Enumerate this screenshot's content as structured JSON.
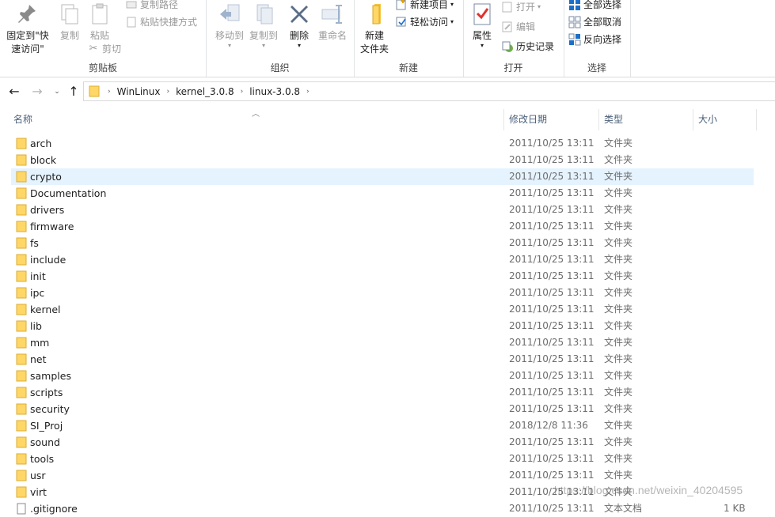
{
  "ribbon": {
    "clipboard": {
      "label": "剪贴板",
      "pin_label": "固定到\"快速访问\"",
      "copy_label": "复制",
      "paste_label": "粘贴",
      "copy_path_label": "复制路径",
      "paste_shortcut_label": "粘贴快捷方式",
      "cut_label": "剪切"
    },
    "organize": {
      "label": "组织",
      "move_to_label": "移动到",
      "copy_to_label": "复制到",
      "delete_label": "删除",
      "rename_label": "重命名"
    },
    "new": {
      "label": "新建",
      "new_folder_label": "新建\n文件夹",
      "new_item_label": "新建项目",
      "easy_access_label": "轻松访问"
    },
    "open": {
      "label": "打开",
      "properties_label": "属性",
      "open_label": "打开",
      "edit_label": "编辑",
      "history_label": "历史记录"
    },
    "select": {
      "label": "选择",
      "select_all_label": "全部选择",
      "select_none_label": "全部取消",
      "invert_label": "反向选择"
    }
  },
  "nav": {
    "breadcrumb": [
      "WinLinux",
      "kernel_3.0.8",
      "linux-3.0.8"
    ]
  },
  "columns": {
    "name": "名称",
    "date": "修改日期",
    "type": "类型",
    "size": "大小"
  },
  "files": [
    {
      "name": "arch",
      "date": "2011/10/25 13:11",
      "type": "文件夹",
      "size": "",
      "kind": "folder"
    },
    {
      "name": "block",
      "date": "2011/10/25 13:11",
      "type": "文件夹",
      "size": "",
      "kind": "folder"
    },
    {
      "name": "crypto",
      "date": "2011/10/25 13:11",
      "type": "文件夹",
      "size": "",
      "kind": "folder",
      "selected": true
    },
    {
      "name": "Documentation",
      "date": "2011/10/25 13:11",
      "type": "文件夹",
      "size": "",
      "kind": "folder"
    },
    {
      "name": "drivers",
      "date": "2011/10/25 13:11",
      "type": "文件夹",
      "size": "",
      "kind": "folder"
    },
    {
      "name": "firmware",
      "date": "2011/10/25 13:11",
      "type": "文件夹",
      "size": "",
      "kind": "folder"
    },
    {
      "name": "fs",
      "date": "2011/10/25 13:11",
      "type": "文件夹",
      "size": "",
      "kind": "folder"
    },
    {
      "name": "include",
      "date": "2011/10/25 13:11",
      "type": "文件夹",
      "size": "",
      "kind": "folder"
    },
    {
      "name": "init",
      "date": "2011/10/25 13:11",
      "type": "文件夹",
      "size": "",
      "kind": "folder"
    },
    {
      "name": "ipc",
      "date": "2011/10/25 13:11",
      "type": "文件夹",
      "size": "",
      "kind": "folder"
    },
    {
      "name": "kernel",
      "date": "2011/10/25 13:11",
      "type": "文件夹",
      "size": "",
      "kind": "folder"
    },
    {
      "name": "lib",
      "date": "2011/10/25 13:11",
      "type": "文件夹",
      "size": "",
      "kind": "folder"
    },
    {
      "name": "mm",
      "date": "2011/10/25 13:11",
      "type": "文件夹",
      "size": "",
      "kind": "folder"
    },
    {
      "name": "net",
      "date": "2011/10/25 13:11",
      "type": "文件夹",
      "size": "",
      "kind": "folder"
    },
    {
      "name": "samples",
      "date": "2011/10/25 13:11",
      "type": "文件夹",
      "size": "",
      "kind": "folder"
    },
    {
      "name": "scripts",
      "date": "2011/10/25 13:11",
      "type": "文件夹",
      "size": "",
      "kind": "folder"
    },
    {
      "name": "security",
      "date": "2011/10/25 13:11",
      "type": "文件夹",
      "size": "",
      "kind": "folder"
    },
    {
      "name": "SI_Proj",
      "date": "2018/12/8 11:36",
      "type": "文件夹",
      "size": "",
      "kind": "folder"
    },
    {
      "name": "sound",
      "date": "2011/10/25 13:11",
      "type": "文件夹",
      "size": "",
      "kind": "folder"
    },
    {
      "name": "tools",
      "date": "2011/10/25 13:11",
      "type": "文件夹",
      "size": "",
      "kind": "folder"
    },
    {
      "name": "usr",
      "date": "2011/10/25 13:11",
      "type": "文件夹",
      "size": "",
      "kind": "folder"
    },
    {
      "name": "virt",
      "date": "2011/10/25 13:11",
      "type": "文件夹",
      "size": "",
      "kind": "folder"
    },
    {
      "name": ".gitignore",
      "date": "2011/10/25 13:11",
      "type": "文本文档",
      "size": "1 KB",
      "kind": "file"
    }
  ],
  "watermark": "https://blog.csdn.net/weixin_40204595",
  "colors": {
    "folder": "#ffd766",
    "selection": "#e5f3ff",
    "header_text": "#4c607a",
    "accent_blue": "#1c6fc9"
  }
}
